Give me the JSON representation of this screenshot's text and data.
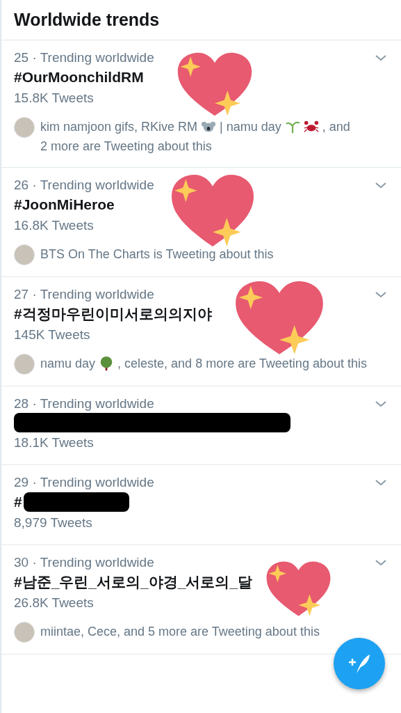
{
  "header": {
    "title": "Worldwide trends"
  },
  "trends": [
    {
      "rank": "25 · Trending worldwide",
      "title": "#OurMoonchildRM",
      "redacted": false,
      "count": "15.8K Tweets",
      "sticker": true,
      "context": [
        {
          "kind": "text",
          "text": "kim namjoon gifs, RKive RM"
        },
        {
          "kind": "koala"
        },
        {
          "kind": "text",
          "text": "| namu day"
        },
        {
          "kind": "sprout"
        },
        {
          "kind": "crab"
        },
        {
          "kind": "text",
          "text": ", and"
        },
        {
          "kind": "text",
          "text": "2 more are Tweeting about this"
        }
      ]
    },
    {
      "rank": "26 · Trending worldwide",
      "title": "#JoonMiHeroe",
      "redacted": false,
      "count": "16.8K Tweets",
      "sticker": true,
      "context": [
        {
          "kind": "text",
          "text": "BTS On The Charts is Tweeting about this"
        }
      ]
    },
    {
      "rank": "27 · Trending worldwide",
      "title": "#걱정마우린이미서로의의지야",
      "redacted": false,
      "count": "145K Tweets",
      "sticker": true,
      "context": [
        {
          "kind": "text",
          "text": "namu day"
        },
        {
          "kind": "tree"
        },
        {
          "kind": "text",
          "text": ", celeste, and 8 more are Tweeting about"
        },
        {
          "kind": "text",
          "text": "this"
        }
      ]
    },
    {
      "rank": "28 · Trending worldwide",
      "redacted": true,
      "count": "18.1K Tweets",
      "sticker": false
    },
    {
      "rank": "29 · Trending worldwide",
      "title": "#",
      "redacted": true,
      "count": "8,979 Tweets",
      "sticker": false
    },
    {
      "rank": "30 · Trending worldwide",
      "title": "#남준_우린_서로의_야경_서로의_달",
      "redacted": false,
      "count": "26.8K Tweets",
      "sticker": true,
      "context": [
        {
          "kind": "text",
          "text": "miintae, Cece, and 5 more are Tweeting about this"
        }
      ]
    }
  ],
  "compose": {
    "shown": true
  }
}
